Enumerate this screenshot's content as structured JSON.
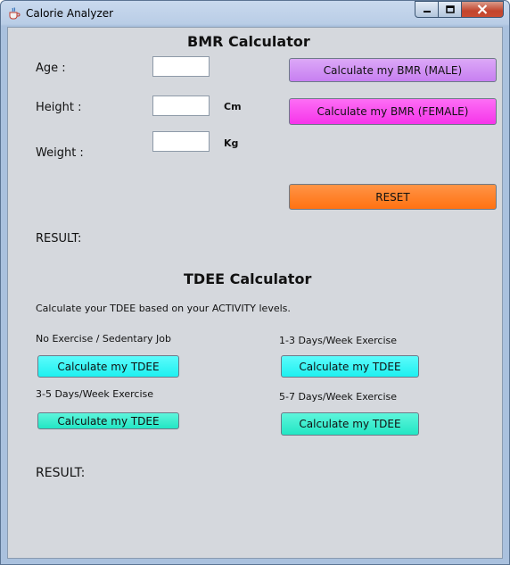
{
  "window": {
    "title": "Calorie Analyzer",
    "icon": "java-cup-icon"
  },
  "bmr": {
    "heading": "BMR Calculator",
    "age_label": "Age :",
    "height_label": "Height :",
    "weight_label": "Weight :",
    "height_unit": "Cm",
    "weight_unit": "Kg",
    "age_value": "",
    "height_value": "",
    "weight_value": "",
    "male_button": "Calculate my BMR (MALE)",
    "female_button": "Calculate my BMR (FEMALE)",
    "reset_button": "RESET",
    "result_label": "RESULT:"
  },
  "tdee": {
    "heading": "TDEE Calculator",
    "description": "Calculate your TDEE based on your ACTIVITY levels.",
    "levels": [
      {
        "label": "No Exercise / Sedentary Job",
        "button": "Calculate my TDEE"
      },
      {
        "label": "1-3 Days/Week Exercise",
        "button": "Calculate my TDEE"
      },
      {
        "label": "3-5 Days/Week Exercise",
        "button": "Calculate my TDEE"
      },
      {
        "label": "5-7 Days/Week Exercise",
        "button": "Calculate my TDEE"
      }
    ],
    "result_label": "RESULT:"
  },
  "colors": {
    "male_button": "#cc88f3",
    "female_button": "#fb40f0",
    "reset_button": "#ff7a1e",
    "tdee_button_cyan": "#1ef6f6",
    "tdee_button_teal": "#28eed0",
    "panel_background": "#d5d8dd"
  }
}
